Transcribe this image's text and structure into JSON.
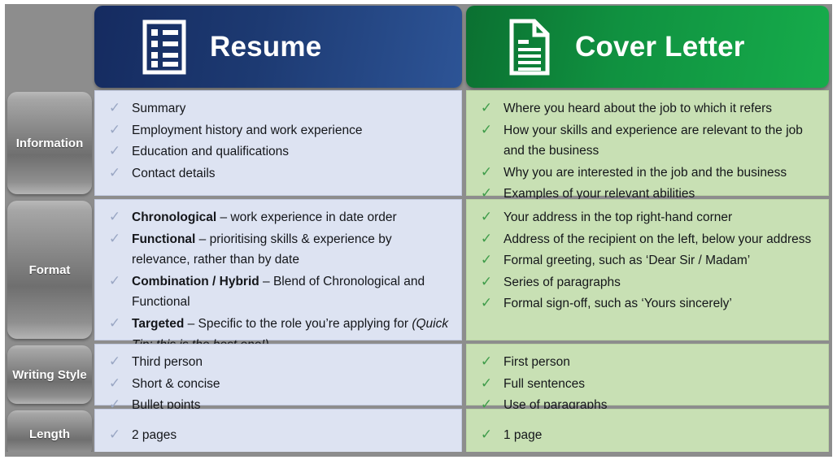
{
  "columns": [
    {
      "key": "resume",
      "title": "Resume",
      "icon": "resume-list-icon",
      "accent": "#1d3a72",
      "cell_bg": "#dde3f2",
      "tick_color": "#9aa7c4"
    },
    {
      "key": "cover",
      "title": "Cover Letter",
      "icon": "document-page-icon",
      "accent": "#109140",
      "cell_bg": "#c8e0b4",
      "tick_color": "#3f9c4a"
    }
  ],
  "rows": [
    {
      "label": "Information",
      "resume": [
        {
          "text": "Summary"
        },
        {
          "text": "Employment history and work experience"
        },
        {
          "text": "Education and qualifications"
        },
        {
          "text": "Contact details"
        }
      ],
      "cover": [
        {
          "text": "Where you heard about the job to which it refers"
        },
        {
          "text": "How your skills and experience are relevant to the job and the business"
        },
        {
          "text": "Why you are interested in the job and the business"
        },
        {
          "text": "Examples of your relevant abilities"
        }
      ]
    },
    {
      "label": "Format",
      "resume": [
        {
          "bold": "Chronological",
          "text": " – work experience in date order"
        },
        {
          "bold": "Functional",
          "text": " – prioritising skills & experience by relevance, rather than by date"
        },
        {
          "bold": "Combination / Hybrid",
          "text": " – Blend of Chronological and Functional"
        },
        {
          "bold": "Targeted",
          "text": " – Specific to the role you’re applying for ",
          "italic": "(Quick Tip: this is the best one!)"
        }
      ],
      "cover": [
        {
          "text": "Your address in the top right-hand corner"
        },
        {
          "text": "Address of the recipient on the left, below your address"
        },
        {
          "text": "Formal greeting, such as ‘Dear Sir / Madam’"
        },
        {
          "text": "Series of paragraphs"
        },
        {
          "text": "Formal sign-off, such as ‘Yours sincerely’"
        }
      ]
    },
    {
      "label": "Writing Style",
      "resume": [
        {
          "text": "Third person"
        },
        {
          "text": "Short & concise"
        },
        {
          "text": "Bullet points"
        }
      ],
      "cover": [
        {
          "text": "First person"
        },
        {
          "text": "Full sentences"
        },
        {
          "text": "Use of paragraphs"
        }
      ]
    },
    {
      "label": "Length",
      "resume": [
        {
          "text": "2 pages"
        }
      ],
      "cover": [
        {
          "text": "1 page"
        }
      ]
    }
  ],
  "tick_glyph": "✓"
}
